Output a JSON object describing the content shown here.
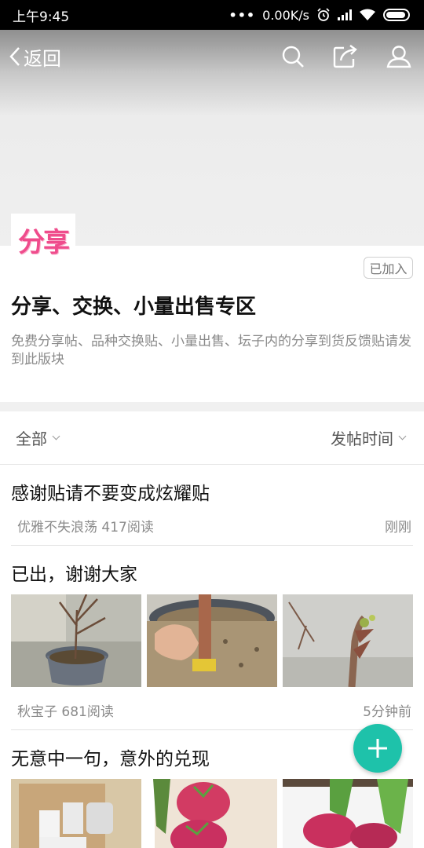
{
  "status": {
    "time": "上午9:45",
    "speed": "0.00K/s",
    "dots": "•••"
  },
  "nav": {
    "back_label": "返回"
  },
  "forum": {
    "logo_text": "分享",
    "joined_label": "已加入",
    "title": "分享、交换、小量出售专区",
    "description": "免费分享帖、品种交换贴、小量出售、坛子内的分享到货反馈贴请发到此版块"
  },
  "filters": {
    "left": "全部",
    "right": "发帖时间"
  },
  "posts": [
    {
      "title": "感谢贴请不要变成炫耀贴",
      "author_reads": "优雅不失浪荡 417阅读",
      "time": "刚刚"
    },
    {
      "title": "已出，谢谢大家",
      "author_reads": "秋宝子 681阅读",
      "time": "5分钟前"
    },
    {
      "title": "无意中一句，意外的兑现"
    }
  ]
}
